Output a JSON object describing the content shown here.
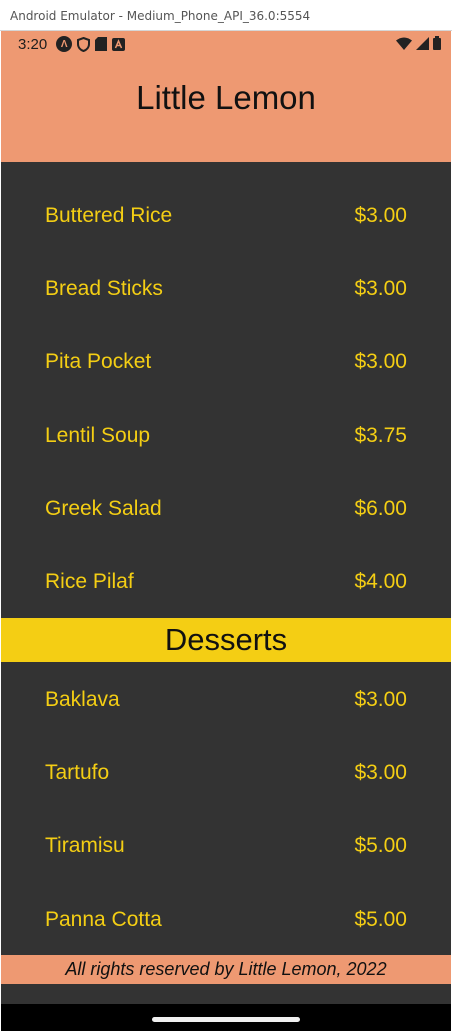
{
  "window": {
    "title": "Android Emulator - Medium_Phone_API_36.0:5554"
  },
  "status_bar": {
    "time": "3:20",
    "icons": [
      "android-auto-icon",
      "shield-icon",
      "sd-card-icon",
      "notification-a-icon",
      "wifi-icon",
      "signal-icon",
      "battery-icon"
    ]
  },
  "header": {
    "title": "Little Lemon"
  },
  "main_items": [
    {
      "name": "Buttered Rice",
      "price": "$3.00"
    },
    {
      "name": "Bread Sticks",
      "price": "$3.00"
    },
    {
      "name": "Pita Pocket",
      "price": "$3.00"
    },
    {
      "name": "Lentil Soup",
      "price": "$3.75"
    },
    {
      "name": "Greek Salad",
      "price": "$6.00"
    },
    {
      "name": "Rice Pilaf",
      "price": "$4.00"
    }
  ],
  "desserts_section": {
    "title": "Desserts"
  },
  "dessert_items": [
    {
      "name": "Baklava",
      "price": "$3.00"
    },
    {
      "name": "Tartufo",
      "price": "$3.00"
    },
    {
      "name": "Tiramisu",
      "price": "$5.00"
    },
    {
      "name": "Panna Cotta",
      "price": "$5.00"
    }
  ],
  "footer": {
    "text": "All rights reserved by Little Lemon, 2022"
  },
  "colors": {
    "primary_salmon": "#EE9972",
    "background_dark": "#333333",
    "accent_yellow": "#F4CE14"
  }
}
